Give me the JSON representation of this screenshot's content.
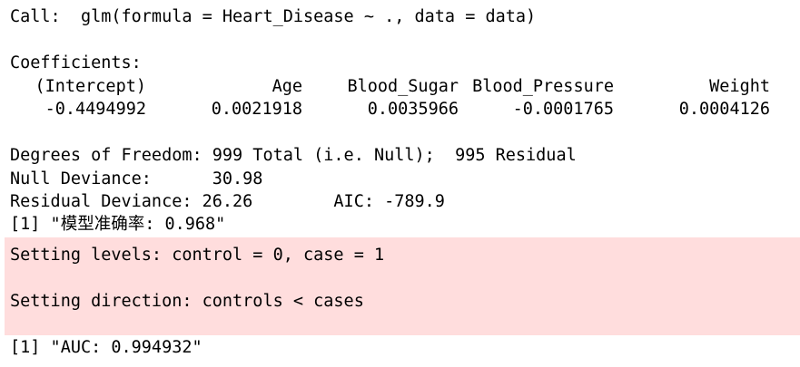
{
  "console": {
    "call_line": "Call:  glm(formula = Heart_Disease ~ ., data = data)",
    "coefficients_label": "Coefficients:",
    "coefficients": {
      "headers": [
        "(Intercept)",
        "Age",
        "Blood_Sugar",
        "Blood_Pressure",
        "Weight"
      ],
      "values": [
        "-0.4494992",
        "0.0021918",
        "0.0035966",
        "-0.0001765",
        "0.0004126"
      ]
    },
    "dof_line": "Degrees of Freedom: 999 Total (i.e. Null);  995 Residual",
    "null_deviance_line": "Null Deviance:      30.98",
    "residual_deviance_line": "Residual Deviance: 26.26        AIC: -789.9",
    "accuracy_line": "[1] \"模型准确率: 0.968\"",
    "messages": {
      "levels": "Setting levels: control = 0, case = 1",
      "direction": "Setting direction: controls < cases",
      "background_color": "#ffdddd"
    },
    "auc_line": "[1] \"AUC: 0.994932\""
  }
}
